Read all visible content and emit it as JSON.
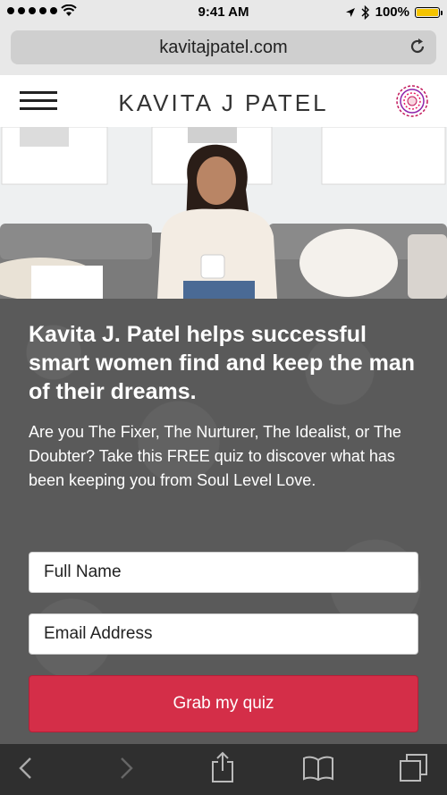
{
  "status_bar": {
    "time": "9:41 AM",
    "battery_text": "100%",
    "battery_level": 1.0,
    "icons": [
      "signal-dots-icon",
      "wifi-icon",
      "location-icon",
      "bluetooth-icon",
      "battery-icon"
    ]
  },
  "browser": {
    "url": "kavitajpatel.com",
    "icons": [
      "reload-icon",
      "back-icon",
      "forward-icon",
      "share-icon",
      "bookmarks-icon",
      "tabs-icon"
    ]
  },
  "header": {
    "logo_text": "KAVITA J PATEL",
    "icons": [
      "hamburger-menu-icon",
      "mandala-logo-icon"
    ]
  },
  "hero": {
    "description_icon": "hero-photo"
  },
  "main": {
    "headline": "Kavita J. Patel helps successful smart women find and keep the man of their dreams.",
    "subtext": "Are you The Fixer, The Nurturer, The Idealist, or The Doubter? Take this FREE quiz to discover what has been keeping you from Soul Level Love.",
    "full_name_placeholder": "Full Name",
    "email_placeholder": "Email Address",
    "submit_label": "Grab my quiz"
  },
  "colors": {
    "accent": "#d42e48",
    "battery": "#f5c400",
    "form_bg": "#5a5a5a",
    "toolbar_bg": "#2f2f2f"
  }
}
